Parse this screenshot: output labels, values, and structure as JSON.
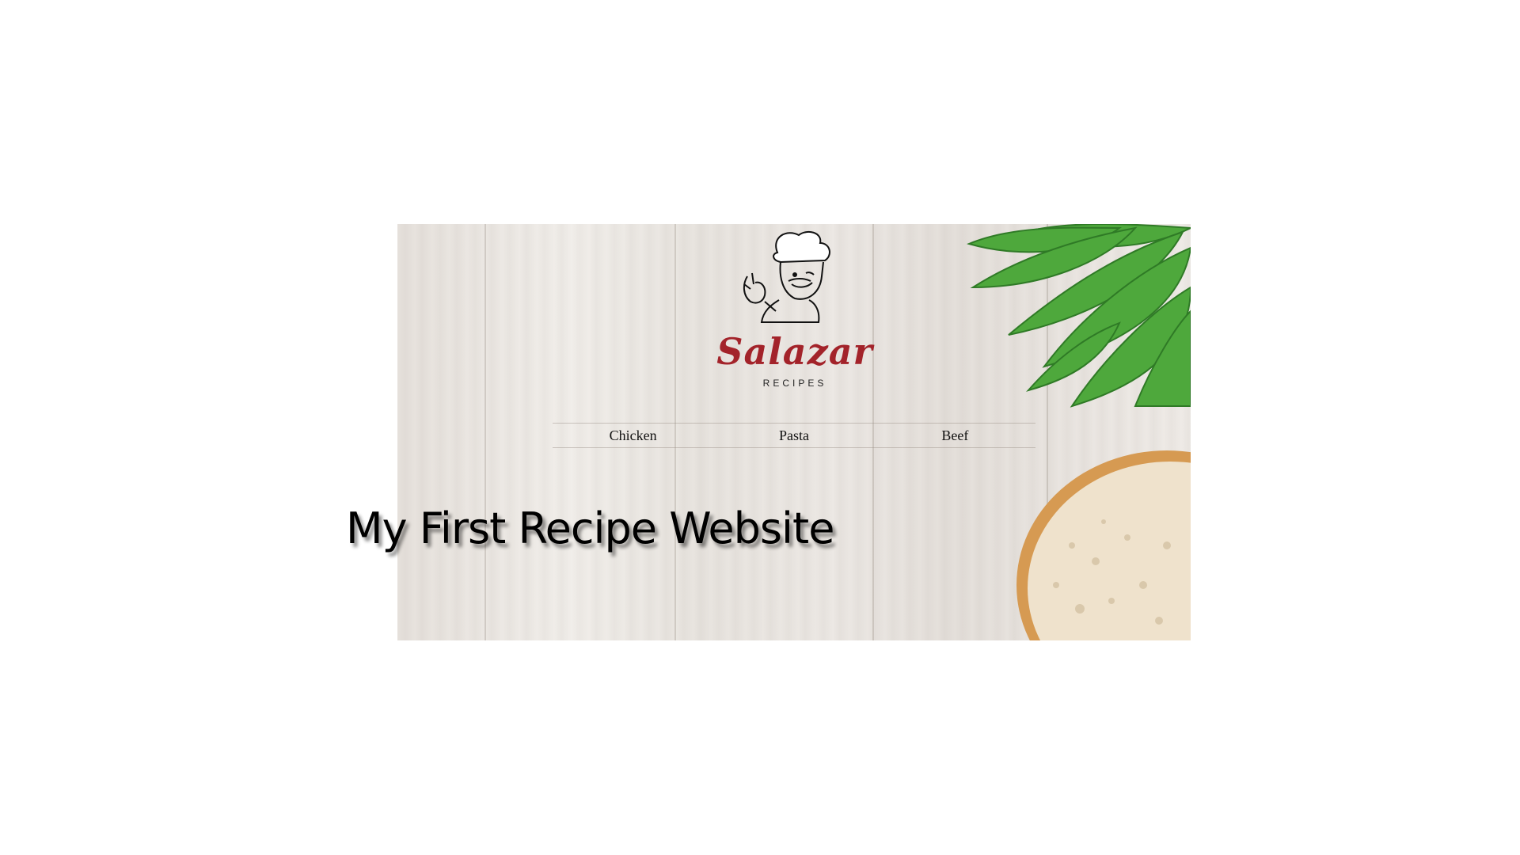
{
  "brand": {
    "name": "Salazar",
    "tagline": "RECIPES"
  },
  "nav": {
    "items": [
      {
        "label": "Chicken"
      },
      {
        "label": "Pasta"
      },
      {
        "label": "Beef"
      }
    ]
  },
  "hero": {
    "headline": "My First Recipe Website"
  },
  "colors": {
    "page_background": "#ffffff",
    "brand_red": "#a3232a",
    "wood": "#ece8e4",
    "greens": "#4aa63a",
    "bread_crust": "#d69a52"
  },
  "icons": {
    "logo": "chef-illustration",
    "decor_top": "herb-leaves",
    "decor_bottom": "bread-slice"
  }
}
